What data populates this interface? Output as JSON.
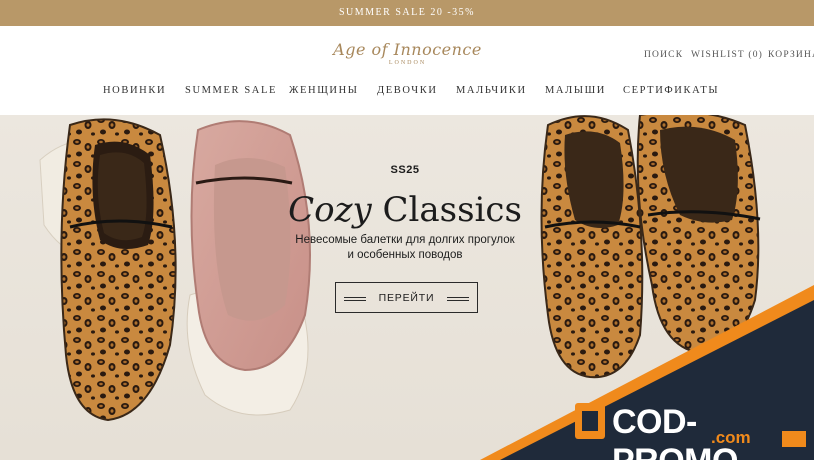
{
  "announcement": "SUMMER SALE 20 -35%",
  "brand": {
    "name": "Age of Innocence",
    "location": "LONDON",
    "accent": "#b89868"
  },
  "utility": {
    "search": "ПОИСК",
    "wishlist": "WISHLIST (0)",
    "cart": "КОРЗИНА"
  },
  "nav": {
    "items": [
      {
        "label": "НОВИНКИ"
      },
      {
        "label": "SUMMER SALE"
      },
      {
        "label": "ЖЕНЩИНЫ"
      },
      {
        "label": "ДЕВОЧКИ"
      },
      {
        "label": "МАЛЬЧИКИ"
      },
      {
        "label": "МАЛЫШИ"
      },
      {
        "label": "СЕРТИФИКАТЫ"
      }
    ]
  },
  "hero": {
    "kicker": "SS25",
    "title_italic": "Cozy",
    "title_rest": " Classics",
    "subtitle_line1": "Невесомые балетки для долгих прогулок",
    "subtitle_line2": "и особенных поводов",
    "cta_label": "ПЕРЕЙТИ"
  },
  "watermark": {
    "text": "COD-PROMO",
    "sub": ".com",
    "orange": "#f08a1c",
    "dark": "#1f2a3a"
  }
}
